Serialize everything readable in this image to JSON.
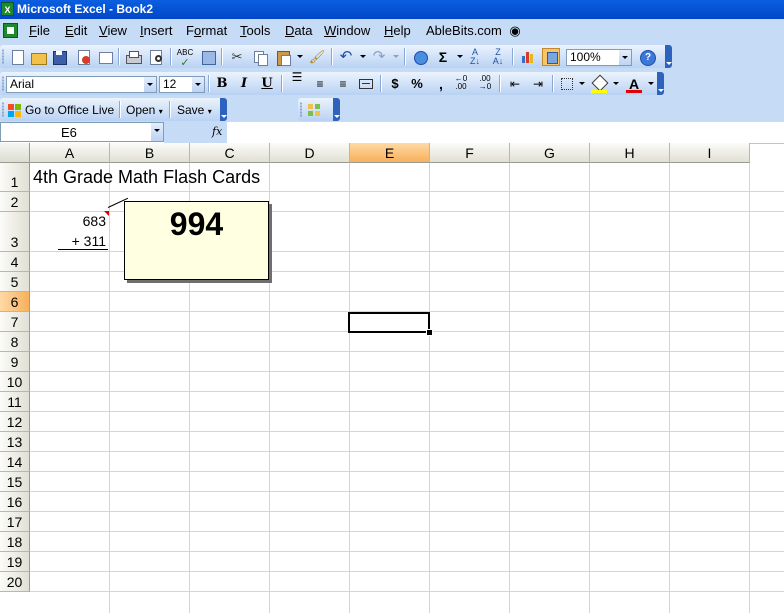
{
  "window": {
    "title": "Microsoft Excel - Book2"
  },
  "menu": [
    "File",
    "Edit",
    "View",
    "Insert",
    "Format",
    "Tools",
    "Data",
    "Window",
    "Help",
    "AbleBits.com"
  ],
  "menu_underline": [
    "F",
    "E",
    "V",
    "I",
    "o",
    "T",
    "D",
    "W",
    "H",
    ""
  ],
  "menu_rest": [
    "ile",
    "dit",
    "iew",
    "nsert",
    "rmat",
    "ools",
    "ata",
    "indow",
    "elp",
    "AbleBits.com"
  ],
  "menu_pre": [
    "",
    "",
    "",
    "",
    "F",
    "",
    "",
    "",
    "",
    ""
  ],
  "standard_toolbar": {
    "zoom": "100%",
    "sum_icon": "Σ"
  },
  "formatting_toolbar": {
    "font_name": "Arial",
    "font_size": "12",
    "bold": "B",
    "italic": "I",
    "underline": "U",
    "currency": "$",
    "percent": "%",
    "comma": ",",
    "font_color_letter": "A",
    "font_color": "#e00000",
    "fill_color": "#ffff00"
  },
  "office_live_toolbar": {
    "goto_label": "Go to Office Live",
    "open_label": "Open",
    "save_label": "Save"
  },
  "formula_bar": {
    "name_box": "E6",
    "fx_label": "fx",
    "content": ""
  },
  "columns": [
    "A",
    "B",
    "C",
    "D",
    "E",
    "F",
    "G",
    "H",
    "I"
  ],
  "selected_column": "E",
  "rows": [
    "1",
    "2",
    "3",
    "4",
    "5",
    "6",
    "7",
    "8",
    "9",
    "10",
    "11",
    "12",
    "13",
    "14",
    "15",
    "16",
    "17",
    "18",
    "19",
    "20"
  ],
  "selected_row": "6",
  "cells": {
    "A1": "4th Grade Math Flash Cards",
    "A3_top": "683",
    "A3_bottom": "+ 311"
  },
  "comment": {
    "cell": "A3",
    "text": "994"
  }
}
